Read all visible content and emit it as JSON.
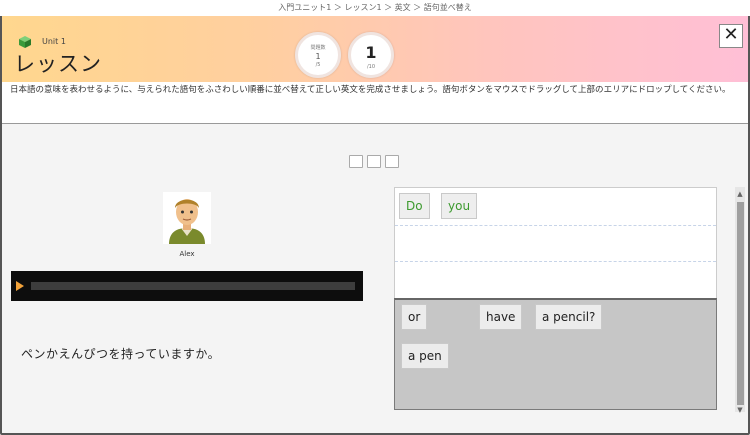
{
  "breadcrumb": "入門ユニット1 ＞ レッスン1 ＞ 英文 ＞ 語句並べ替え",
  "header": {
    "subtitle": "Unit 1",
    "title": "レッスン",
    "progress_top": "問題数",
    "progress_mid": "1",
    "progress_bottom": "/5",
    "question_number": "1",
    "question_sub": "/10",
    "close_label": "✕"
  },
  "instructions": "日本語の意味を表わせるように、与えられた語句をふさわしい順番に並べ替えて正しい英文を完成させましょう。語句ボタンをマウスでドラッグして上部のエリアにドロップしてください。",
  "speaker": {
    "name": "Alex"
  },
  "question_text": "ペンかえんぴつを持っていますか。",
  "answer_words": [
    "Do",
    "you"
  ],
  "choice_words": [
    "or",
    "have",
    "a pencil?",
    "a pen"
  ],
  "colors": {
    "placed_word": "#3c9a2e",
    "play_button": "#f2a23a"
  }
}
